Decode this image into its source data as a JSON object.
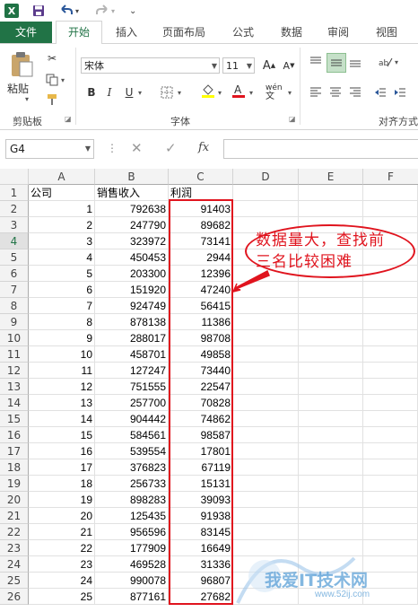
{
  "quick_access": {
    "excel_icon": "X",
    "icons": [
      "save-icon",
      "undo-icon",
      "redo-icon",
      "customize-icon"
    ]
  },
  "tabs": [
    "文件",
    "开始",
    "插入",
    "页面布局",
    "公式",
    "数据",
    "审阅",
    "视图"
  ],
  "ribbon": {
    "paste_label": "粘贴",
    "clipboard_label": "剪贴板",
    "font_name": "宋体",
    "font_size": "11",
    "font_group_label": "字体",
    "align_group_label": "对齐方式",
    "bold": "B",
    "italic": "I",
    "underline": "U",
    "wen": "wén"
  },
  "formula_bar": {
    "name_box": "G4",
    "fx": "fx",
    "value": ""
  },
  "columns": [
    "A",
    "B",
    "C",
    "D",
    "E",
    "F"
  ],
  "selected_row": 4,
  "rows": [
    {
      "n": "1",
      "a": "公司",
      "b": "销售收入",
      "c": "利润"
    },
    {
      "n": "2",
      "a": "1",
      "b": "792638",
      "c": "91403"
    },
    {
      "n": "3",
      "a": "2",
      "b": "247790",
      "c": "89682"
    },
    {
      "n": "4",
      "a": "3",
      "b": "323972",
      "c": "73141"
    },
    {
      "n": "5",
      "a": "4",
      "b": "450453",
      "c": "2944"
    },
    {
      "n": "6",
      "a": "5",
      "b": "203300",
      "c": "12396"
    },
    {
      "n": "7",
      "a": "6",
      "b": "151920",
      "c": "47240"
    },
    {
      "n": "8",
      "a": "7",
      "b": "924749",
      "c": "56415"
    },
    {
      "n": "9",
      "a": "8",
      "b": "878138",
      "c": "11386"
    },
    {
      "n": "10",
      "a": "9",
      "b": "288017",
      "c": "98708"
    },
    {
      "n": "11",
      "a": "10",
      "b": "458701",
      "c": "49858"
    },
    {
      "n": "12",
      "a": "11",
      "b": "127247",
      "c": "73440"
    },
    {
      "n": "13",
      "a": "12",
      "b": "751555",
      "c": "22547"
    },
    {
      "n": "14",
      "a": "13",
      "b": "257700",
      "c": "70828"
    },
    {
      "n": "15",
      "a": "14",
      "b": "904442",
      "c": "74862"
    },
    {
      "n": "16",
      "a": "15",
      "b": "584561",
      "c": "98587"
    },
    {
      "n": "17",
      "a": "16",
      "b": "539554",
      "c": "17801"
    },
    {
      "n": "18",
      "a": "17",
      "b": "376823",
      "c": "67119"
    },
    {
      "n": "19",
      "a": "18",
      "b": "256733",
      "c": "15131"
    },
    {
      "n": "20",
      "a": "19",
      "b": "898283",
      "c": "39093"
    },
    {
      "n": "21",
      "a": "20",
      "b": "125435",
      "c": "91938"
    },
    {
      "n": "22",
      "a": "21",
      "b": "956596",
      "c": "83145"
    },
    {
      "n": "23",
      "a": "22",
      "b": "177909",
      "c": "16649"
    },
    {
      "n": "24",
      "a": "23",
      "b": "469528",
      "c": "31336"
    },
    {
      "n": "25",
      "a": "24",
      "b": "990078",
      "c": "96807"
    },
    {
      "n": "26",
      "a": "25",
      "b": "877161",
      "c": "27682"
    }
  ],
  "annotation": {
    "line1": "数据量大，查找前",
    "line2": "三名比较困难",
    "color": "#e0141e"
  },
  "watermark": {
    "text": "我爱IT技术网",
    "url": "www.52ij.com"
  }
}
